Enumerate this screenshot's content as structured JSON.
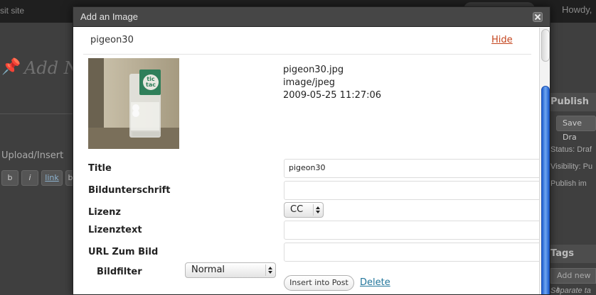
{
  "background": {
    "visit_site": "sit site",
    "howdy": "Howdy,",
    "add_new": "Add N",
    "upload_insert": "Upload/Insert",
    "toolbar": {
      "bold": "b",
      "italic": "i",
      "link": "link",
      "more": "b"
    },
    "publish": {
      "heading": "Publish",
      "save_draft": "Save Dra",
      "status": "Status: Draf",
      "visibility": "Visibility: Pu",
      "publish_immediately": "Publish im"
    },
    "tags": {
      "heading": "Tags",
      "add_new_tag": "Add new t",
      "separate_tags": "Separate ta"
    }
  },
  "modal": {
    "title": "Add an Image",
    "close_icon": "close-icon"
  },
  "attachment": {
    "name": "pigeon30",
    "hide_label": "Hide",
    "file_name": "pigeon30.jpg",
    "mime_type": "image/jpeg",
    "date": "2009-05-25 11:27:06"
  },
  "fields": {
    "title_label": "Title",
    "title_value": "pigeon30",
    "caption_label": "Bildunterschrift",
    "caption_value": "",
    "license_label": "Lizenz",
    "license_value": "CC",
    "license_text_label": "Lizenztext",
    "license_text_value": "",
    "url_label": "URL Zum Bild",
    "url_value": "",
    "filter_label": "Bildfilter",
    "filter_value": "Normal"
  },
  "actions": {
    "insert_label": "Insert into Post",
    "delete_label": "Delete"
  },
  "colors": {
    "titlebar": "#464646",
    "hide_link": "#c4451e",
    "delete_link": "#21759b",
    "scrollbar": "#3b7de0"
  }
}
